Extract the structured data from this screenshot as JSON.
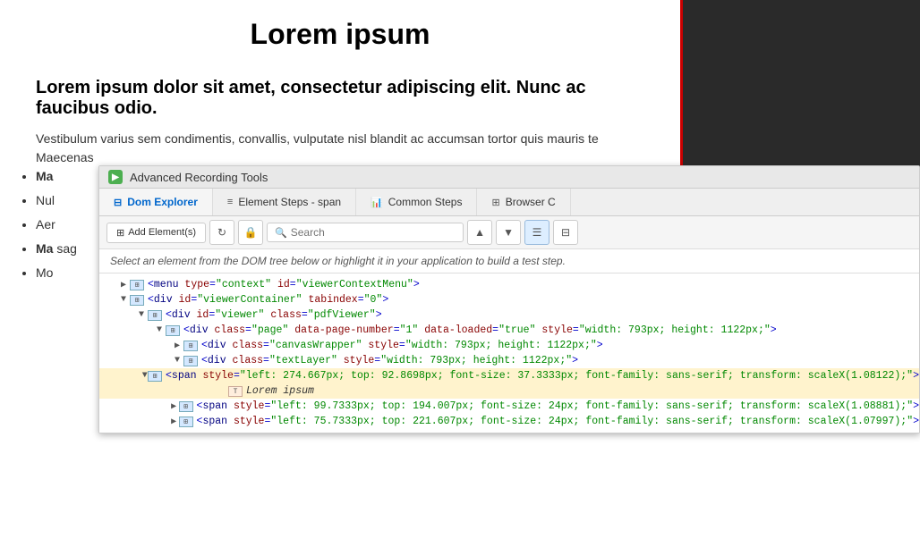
{
  "page": {
    "title": "Lorem ipsum",
    "subtitle": "Lorem ipsum dolor sit amet, consectetur adipiscing elit. Nunc ac faucibus odio.",
    "body_text": "Vestibulum varius sem condimentis, convallis, vulputate nisl blandit ac accumsan tortor quis mauris te",
    "list_intro": "Maecenas",
    "list_items": [
      "Ma",
      "Nul",
      "Aer",
      "Ma sag",
      "Mo"
    ]
  },
  "devtools": {
    "titlebar": {
      "logo_text": "▶",
      "title": "Advanced Recording Tools"
    },
    "tabs": [
      {
        "id": "dom-explorer",
        "label": "Dom Explorer",
        "icon": "⊟",
        "active": true
      },
      {
        "id": "element-steps",
        "label": "Element Steps - span",
        "icon": "≡",
        "active": false
      },
      {
        "id": "common-steps",
        "label": "Common Steps",
        "icon": "📊",
        "active": false
      },
      {
        "id": "browser",
        "label": "Browser C",
        "icon": "⊞",
        "active": false
      }
    ],
    "toolbar": {
      "add_element_label": "Add Element(s)",
      "search_placeholder": "Search",
      "up_icon": "▲",
      "down_icon": "▼",
      "list_icon": "☰",
      "filter_icon": "⊟"
    },
    "instruction": "Select an element from the DOM tree below or highlight it in your application to build a test step.",
    "dom_rows": [
      {
        "id": "row1",
        "indent": 1,
        "collapsed": true,
        "content": "<menu type=\"context\" id=\"viewerContextMenu\">",
        "highlighted": false
      },
      {
        "id": "row2",
        "indent": 1,
        "collapsed": false,
        "content": "<div id=\"viewerContainer\" tabindex=\"0\">",
        "highlighted": false
      },
      {
        "id": "row3",
        "indent": 2,
        "collapsed": false,
        "content": "<div id=\"viewer\" class=\"pdfViewer\">",
        "highlighted": false
      },
      {
        "id": "row4",
        "indent": 3,
        "collapsed": false,
        "content": "<div class=\"page\" data-page-number=\"1\" data-loaded=\"true\" style=\"width: 793px; height: 1122px;\">",
        "highlighted": false
      },
      {
        "id": "row5",
        "indent": 4,
        "collapsed": true,
        "content": "<div class=\"canvasWrapper\" style=\"width: 793px; height: 1122px;\">",
        "highlighted": false
      },
      {
        "id": "row6",
        "indent": 4,
        "collapsed": false,
        "content": "<div class=\"textLayer\" style=\"width: 793px; height: 1122px;\">",
        "highlighted": false
      },
      {
        "id": "row7",
        "indent": 5,
        "collapsed": false,
        "content": "<span style=\"left: 274.667px; top: 92.8698px; font-size: 37.3333px; font-family: sans-serif; transform: scaleX(1.08122);\">",
        "highlighted": true
      },
      {
        "id": "row7-text",
        "indent": 6,
        "collapsed": false,
        "content": "Lorem ipsum",
        "is_text": true,
        "highlighted": true
      },
      {
        "id": "row8",
        "indent": 5,
        "collapsed": true,
        "content": "<span style=\"left: 99.7333px; top: 194.007px; font-size: 24px; font-family: sans-serif; transform: scaleX(1.08881);\">",
        "highlighted": false
      },
      {
        "id": "row9",
        "indent": 5,
        "collapsed": true,
        "content": "<span style=\"left: 75.7333px; top: 221.607px; font-size: 24px; font-family: sans-serif; transform: scaleX(1.07997);\">",
        "highlighted": false
      }
    ]
  }
}
